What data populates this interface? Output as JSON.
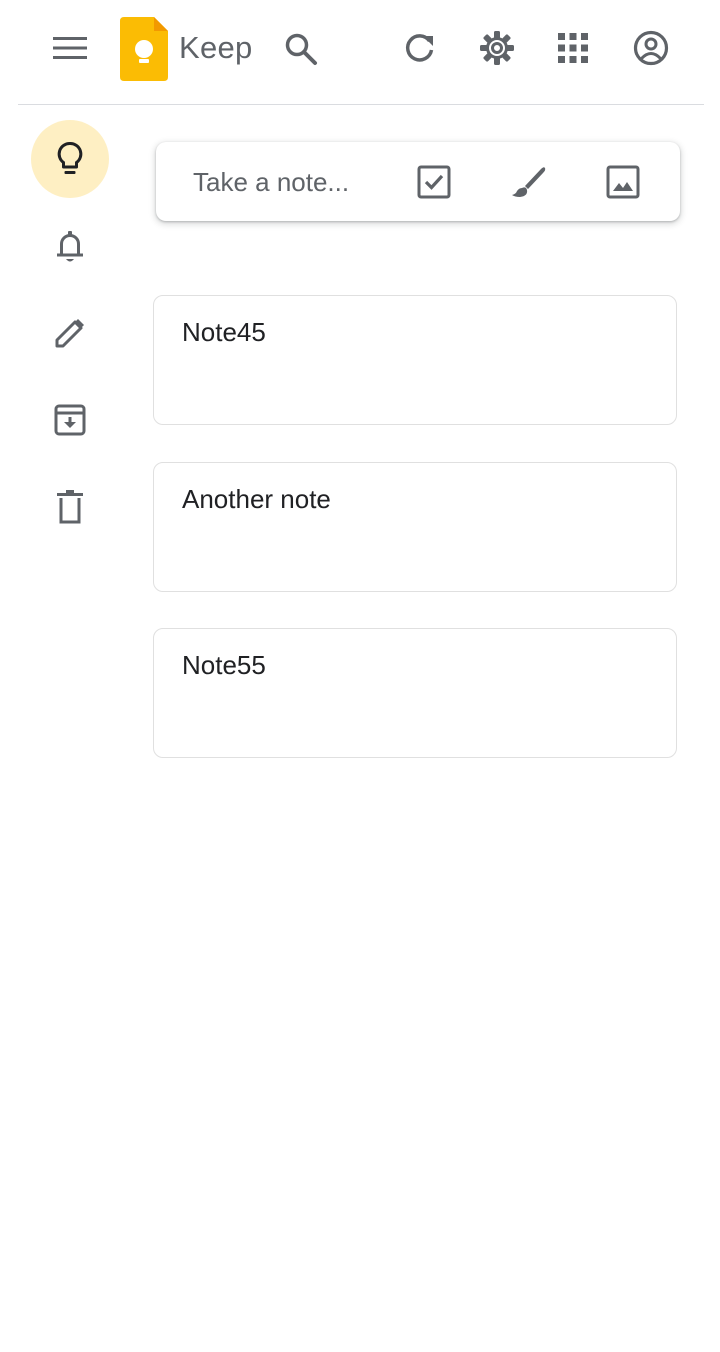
{
  "header": {
    "app_name": "Keep",
    "icons": [
      "main-menu-icon",
      "keep-logo-icon",
      "search-icon",
      "refresh-icon",
      "settings-icon",
      "apps-grid-icon",
      "account-icon"
    ]
  },
  "sidebar": {
    "items": [
      {
        "name": "notes",
        "icon": "lightbulb-icon",
        "active": true
      },
      {
        "name": "reminders",
        "icon": "bell-icon",
        "active": false
      },
      {
        "name": "edit-labels",
        "icon": "pencil-icon",
        "active": false
      },
      {
        "name": "archive",
        "icon": "archive-icon",
        "active": false
      },
      {
        "name": "trash",
        "icon": "trash-icon",
        "active": false
      }
    ]
  },
  "take_note": {
    "placeholder": "Take a note...",
    "actions": [
      "new-list-icon",
      "new-drawing-icon",
      "new-image-icon"
    ]
  },
  "notes": [
    {
      "title": "Note45"
    },
    {
      "title": "Another note"
    },
    {
      "title": "Note55"
    }
  ],
  "colors": {
    "active_nav_bg": "#feefc3",
    "logo_yellow": "#fbbc04",
    "icon_grey": "#5f6368"
  }
}
